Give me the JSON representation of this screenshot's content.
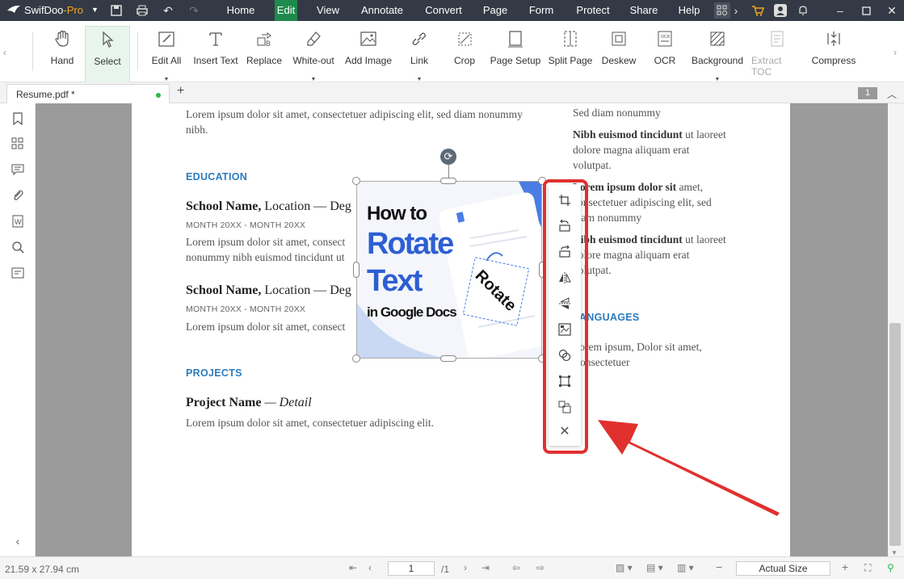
{
  "app": {
    "name_a": "SwifDoo",
    "name_b": "-Pro"
  },
  "menus": [
    "Home",
    "Edit",
    "View",
    "Annotate",
    "Convert",
    "Page",
    "Form",
    "Protect",
    "Share",
    "Help"
  ],
  "ribbon": [
    "Hand",
    "Select",
    "Edit All",
    "Insert Text",
    "Replace",
    "White-out",
    "Add Image",
    "Link",
    "Crop",
    "Page Setup",
    "Split Page",
    "Deskew",
    "OCR",
    "Background",
    "Extract TOC",
    "Compress"
  ],
  "tab": {
    "title": "Resume.pdf *"
  },
  "page_badge": "1",
  "doc": {
    "p1": "Lorem ipsum dolor sit amet, consectetuer adipiscing elit, sed diam nonummy nibh.",
    "education": "EDUCATION",
    "school1_a": "School Name,",
    "school1_b": " Location — Deg",
    "month1": "MONTH 20XX - MONTH 20XX",
    "school1_desc": "Lorem ipsum dolor sit amet, consect nonummy nibh euismod tincidunt ut",
    "school2_a": "School Name,",
    "school2_b": " Location — Deg",
    "month2": "MONTH 20XX - MONTH 20XX",
    "school2_desc": "Lorem ipsum dolor sit amet, consect",
    "projects": "PROJECTS",
    "project_a": "Project Name",
    "project_b": " — Detail",
    "project_desc": "Lorem ipsum dolor sit amet, consectetuer adipiscing elit.",
    "r1": "Sed diam nonummy",
    "r2_b": "Nibh euismod tincidunt",
    "r2": " ut laoreet dolore magna aliquam erat volutpat.",
    "r3_b": "Lorem ipsum dolor sit",
    "r3": " amet, consectetuer adipiscing elit, sed diam nonummy",
    "r4_b": "Nibh euismod tincidunt",
    "r4": " ut laoreet dolore magna aliquam erat volutpat.",
    "languages": "LANGUAGES",
    "r5": "Lorem ipsum, Dolor sit amet, Consectetuer"
  },
  "image": {
    "how": "How to",
    "rotate": "Rotate",
    "text": "Text",
    "in": "in Google Docs",
    "card": "Rotate"
  },
  "context_tools": [
    "crop-icon",
    "rotate-left-icon",
    "rotate-right-icon",
    "flip-horizontal-icon",
    "flip-vertical-icon",
    "replace-image-icon",
    "shapes-icon",
    "fit-icon",
    "extract-icon",
    "close-icon"
  ],
  "status": {
    "size": "21.59 x 27.94 cm",
    "page": "1",
    "total": "/1",
    "zoom": "Actual Size"
  },
  "colors": {
    "accent": "#1f8a4c",
    "titlebar": "#333a45",
    "heading": "#2b7bbd",
    "highlight": "#e0312e"
  }
}
